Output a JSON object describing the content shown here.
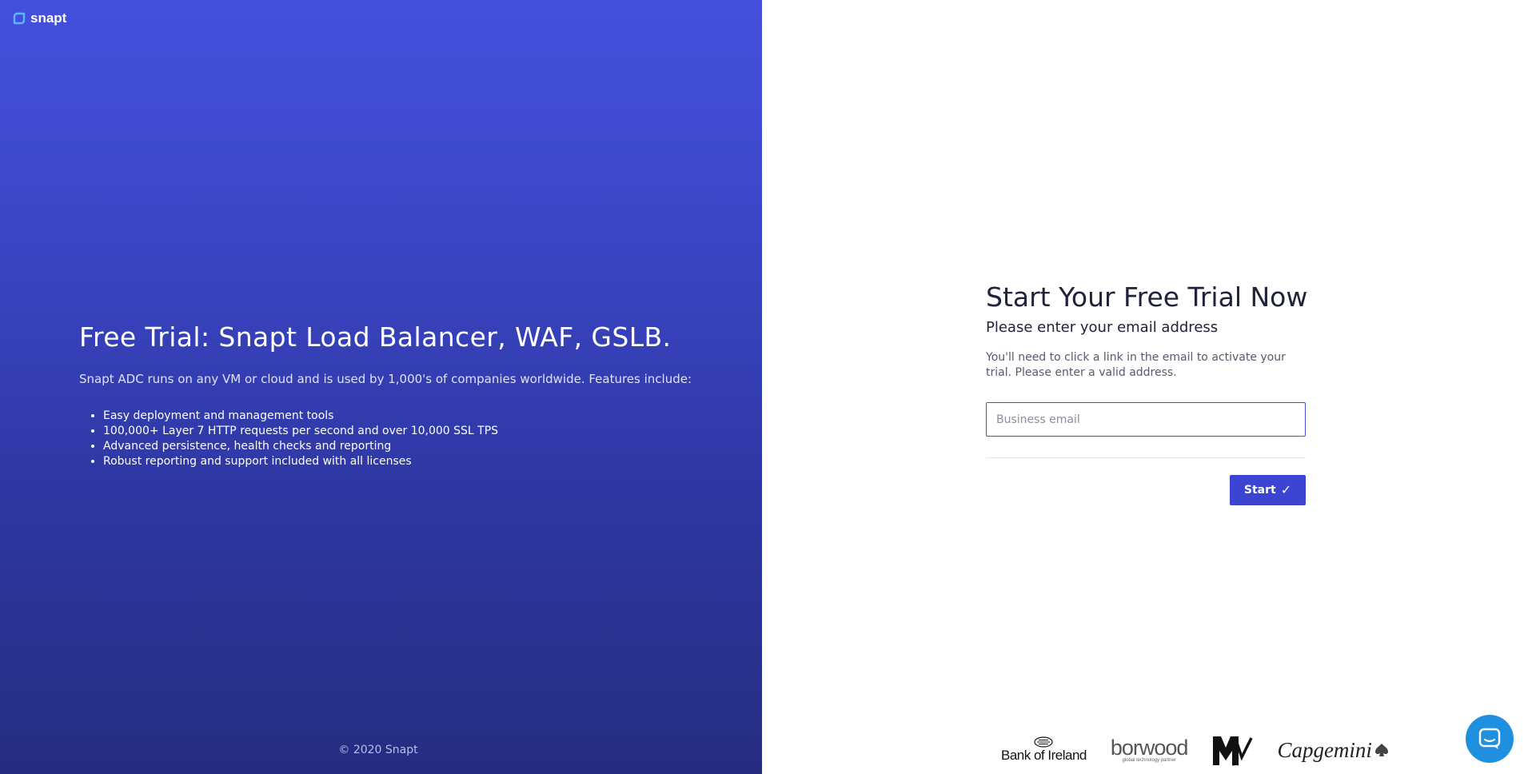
{
  "brand": {
    "logo_text": "snapt"
  },
  "hero": {
    "title": "Free Trial: Snapt Load Balancer, WAF, GSLB.",
    "description": "Snapt ADC runs on any VM or cloud and is used by 1,000's of companies worldwide. Features include:",
    "features": [
      "Easy deployment and management tools",
      "100,000+ Layer 7 HTTP requests per second and over 10,000 SSL TPS",
      "Advanced persistence, health checks and reporting",
      "Robust reporting and support included with all licenses"
    ],
    "copyright": "© 2020 Snapt"
  },
  "form": {
    "title": "Start Your Free Trial Now",
    "subtitle": "Please enter your email address",
    "note": "You'll need to click a link in the email to activate your trial. Please enter a valid address.",
    "email_placeholder": "Business email",
    "email_value": "",
    "start_label": "Start"
  },
  "logos": {
    "bank_of_ireland": "Bank of Ireland",
    "borwood": "borwood",
    "borwood_tagline": "global technology partner",
    "mtv": "MTV",
    "capgemini": "Capgemini"
  },
  "colors": {
    "accent": "#3b45d1",
    "chat": "#1f8fe0",
    "panel_top": "#4450dc",
    "panel_bottom": "#252c80"
  },
  "icons": {
    "chat": "chat-bubble-icon",
    "check": "check-icon"
  }
}
